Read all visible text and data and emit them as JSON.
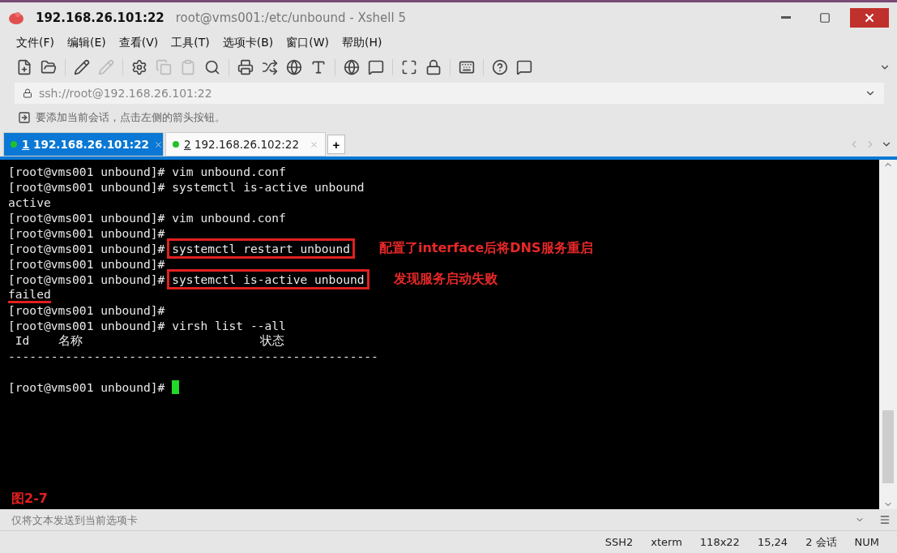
{
  "window": {
    "title": "192.168.26.101:22",
    "subtitle": "root@vms001:/etc/unbound - Xshell 5"
  },
  "menu": [
    "文件(F)",
    "编辑(E)",
    "查看(V)",
    "工具(T)",
    "选项卡(B)",
    "窗口(W)",
    "帮助(H)"
  ],
  "address": {
    "value": "ssh://root@192.168.26.101:22"
  },
  "hint": "要添加当前会话，点击左侧的箭头按钮。",
  "tabs": [
    {
      "number": "1",
      "label": "192.168.26.101:22",
      "selected": true
    },
    {
      "number": "2",
      "label": "192.168.26.102:22",
      "selected": false
    }
  ],
  "new_tab": "+",
  "terminal": {
    "lines": [
      {
        "kind": "prompt",
        "prompt": "[root@vms001 unbound]#",
        "command": "vim unbound.conf"
      },
      {
        "kind": "prompt",
        "prompt": "[root@vms001 unbound]#",
        "command": "systemctl is-active unbound"
      },
      {
        "kind": "output",
        "text": "active"
      },
      {
        "kind": "prompt",
        "prompt": "[root@vms001 unbound]#",
        "command": "vim unbound.conf"
      },
      {
        "kind": "prompt",
        "prompt": "[root@vms001 unbound]#"
      },
      {
        "kind": "prompt",
        "prompt": "[root@vms001 unbound]#",
        "command": "systemctl restart unbound",
        "boxed": true,
        "note": "配置了interface后将DNS服务重启"
      },
      {
        "kind": "prompt",
        "prompt": "[root@vms001 unbound]#"
      },
      {
        "kind": "prompt",
        "prompt": "[root@vms001 unbound]#",
        "command": "systemctl is-active unbound",
        "boxed": true,
        "note": "发现服务启动失败"
      },
      {
        "kind": "output",
        "text": "failed",
        "underlined": true
      },
      {
        "kind": "prompt",
        "prompt": "[root@vms001 unbound]#"
      },
      {
        "kind": "prompt",
        "prompt": "[root@vms001 unbound]#",
        "command": "virsh list --all"
      },
      {
        "kind": "output",
        "text": " Id    名称                         状态"
      },
      {
        "kind": "output",
        "text": "----------------------------------------------------"
      },
      {
        "kind": "blank"
      },
      {
        "kind": "cursor",
        "prompt": "[root@vms001 unbound]#"
      }
    ],
    "figure_label": "图2-7"
  },
  "send_bar": {
    "placeholder": "仅将文本发送到当前选项卡"
  },
  "status_bar": [
    "SSH2",
    "xterm",
    "118x22",
    "15,24",
    "2 会话",
    "NUM"
  ]
}
